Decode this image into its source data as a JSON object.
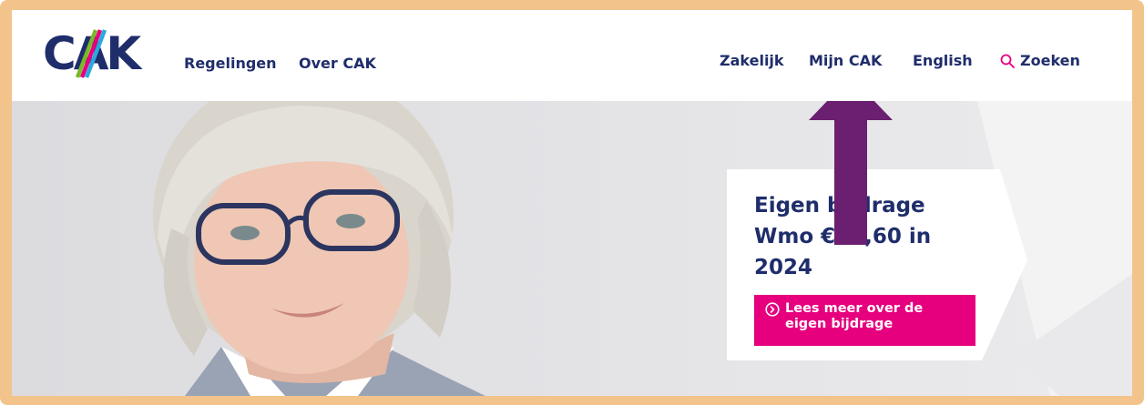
{
  "colors": {
    "frame": "#f2c38b",
    "brand_navy": "#1f2d6b",
    "accent_magenta": "#e6007e",
    "accent_cyan": "#29a9e0",
    "accent_green": "#7ab928",
    "annotation_arrow": "#6b1f70"
  },
  "header": {
    "logo": {
      "text": "CAK"
    },
    "nav_left": [
      {
        "label": "Regelingen"
      },
      {
        "label": "Over CAK"
      }
    ],
    "nav_right": [
      {
        "label": "Zakelijk"
      },
      {
        "label": "Mijn CAK"
      },
      {
        "label": "English"
      }
    ],
    "search": {
      "label": "Zoeken",
      "icon": "search-icon"
    }
  },
  "hero": {
    "image": "smiling-woman-with-glasses",
    "promo": {
      "title": "Eigen bijdrage Wmo €20,60 in 2024",
      "button_label": "Lees meer over de eigen bijdrage",
      "button_icon": "chevron-circle-right-icon"
    }
  },
  "annotation": {
    "icon": "up-arrow-icon",
    "target": "Mijn CAK"
  }
}
